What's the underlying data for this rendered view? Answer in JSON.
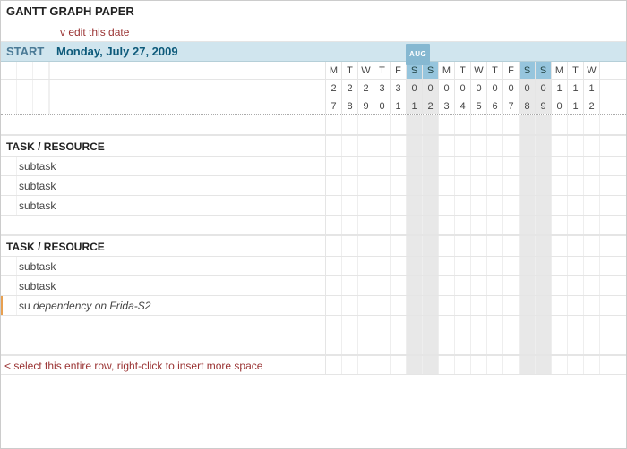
{
  "title": "GANTT GRAPH PAPER",
  "editDateHint": "v edit this date",
  "startLabel": "START",
  "startDate": "Monday, July 27, 2009",
  "monthLabel": "AUG",
  "dayLetters": [
    "M",
    "T",
    "W",
    "T",
    "F",
    "S",
    "S",
    "M",
    "T",
    "W",
    "T",
    "F",
    "S",
    "S",
    "M",
    "T",
    "W"
  ],
  "dayNums1": [
    "2",
    "2",
    "2",
    "3",
    "3",
    "0",
    "0",
    "0",
    "0",
    "0",
    "0",
    "0",
    "0",
    "0",
    "1",
    "1",
    "1"
  ],
  "dayNums2": [
    "7",
    "8",
    "9",
    "0",
    "1",
    "1",
    "2",
    "3",
    "4",
    "5",
    "6",
    "7",
    "8",
    "9",
    "0",
    "1",
    "2"
  ],
  "weekendIdx": [
    5,
    6,
    12,
    13
  ],
  "groups": [
    {
      "header": "TASK / RESOURCE",
      "rows": [
        {
          "type": "subtask",
          "label": "subtask"
        },
        {
          "type": "subtask",
          "label": "subtask"
        },
        {
          "type": "subtask",
          "label": "subtask"
        }
      ]
    },
    {
      "header": "TASK / RESOURCE",
      "rows": [
        {
          "type": "subtask",
          "label": "subtask"
        },
        {
          "type": "subtask",
          "label": "subtask"
        },
        {
          "type": "dep",
          "prefix": "su",
          "label": "dependency on Frida-S2",
          "orangeMarker": true
        }
      ]
    }
  ],
  "insertHint": "< select this entire row, right-click to insert more space"
}
